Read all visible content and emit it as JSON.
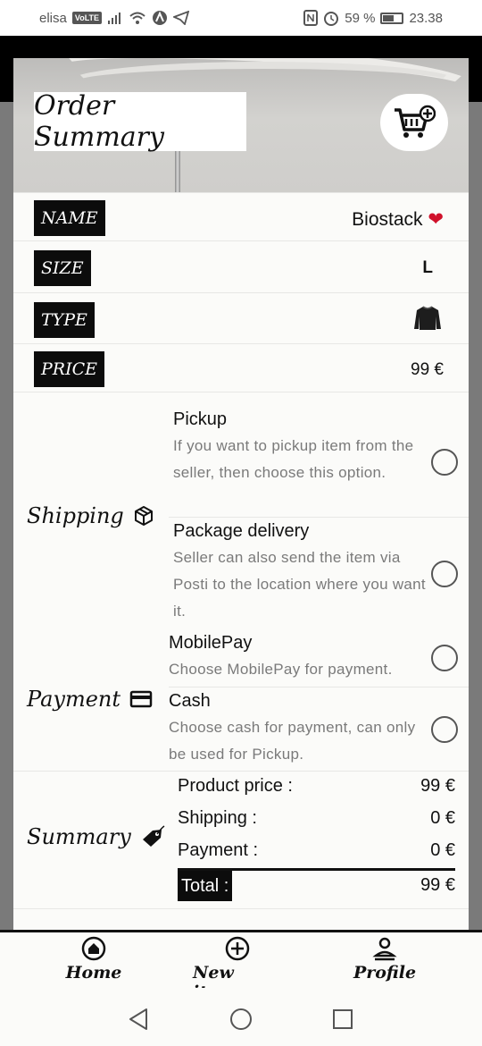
{
  "status_bar": {
    "carrier": "elisa",
    "volte": "VoLTE",
    "battery": "59 %",
    "battery_level": 0.59,
    "time": "23.38"
  },
  "header": {
    "title": "Order Summary",
    "cart_icon": "cart-plus-icon"
  },
  "details": [
    {
      "label": "NAME",
      "value": "Biostack",
      "emoji": "❤️"
    },
    {
      "label": "SIZE",
      "value": "L"
    },
    {
      "label": "TYPE",
      "icon": "sweater-icon"
    },
    {
      "label": "PRICE",
      "value": "99 €"
    }
  ],
  "shipping": {
    "label": "Shipping",
    "icon": "package-icon",
    "options": [
      {
        "title": "Pickup",
        "desc": "If you want to pickup item from the seller, then choose this option."
      },
      {
        "title": "Package delivery",
        "desc": "Seller can also send the item via Posti to the location where you want it."
      }
    ]
  },
  "payment": {
    "label": "Payment",
    "icon": "credit-card-icon",
    "options": [
      {
        "title": "MobilePay",
        "desc": "Choose MobilePay for payment."
      },
      {
        "title": "Cash",
        "desc": "Choose cash for payment, can only be used for Pickup."
      }
    ]
  },
  "summary": {
    "label": "Summary",
    "icon": "price-tag-icon",
    "lines": [
      {
        "label": "Product price :",
        "value": "99 €"
      },
      {
        "label": "Shipping :",
        "value": "0 €"
      },
      {
        "label": "Payment :",
        "value": "0 €"
      }
    ],
    "total_label": "Total :",
    "total_value": "99 €"
  },
  "bottom_nav": [
    {
      "label": "Home",
      "icon": "home-icon"
    },
    {
      "label": "New item",
      "icon": "add-circle-icon"
    },
    {
      "label": "Profile",
      "icon": "profile-icon"
    }
  ],
  "system_nav": [
    "back-icon",
    "home-circle-icon",
    "recents-icon"
  ]
}
